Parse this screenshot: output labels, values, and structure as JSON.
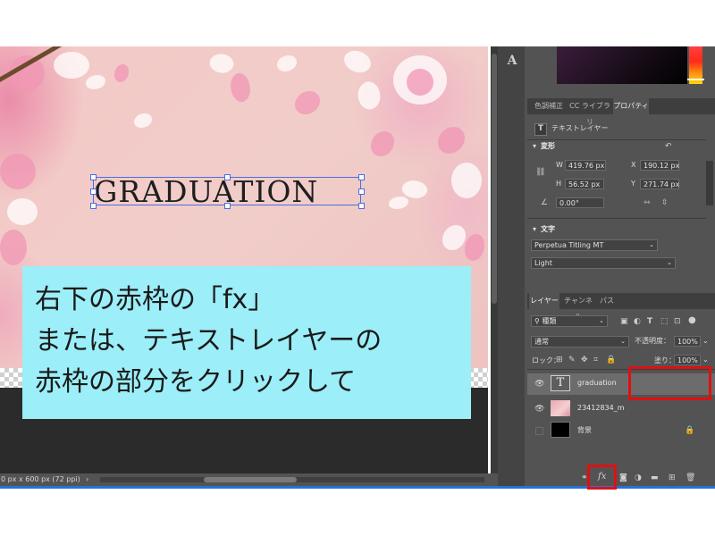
{
  "canvas": {
    "text_layer_content": "GRADUATION",
    "status": "0 px x 600 px (72 ppi)",
    "status_arrow": "›"
  },
  "callout": {
    "line1": "右下の赤枠の「fx」",
    "line2": "または、テキストレイヤーの",
    "line3": "赤枠の部分をクリックして",
    "bg_color": "#9ceef8"
  },
  "toolbar": {
    "type_tool_glyph": "A"
  },
  "properties_panel": {
    "tabs": [
      "色調補正",
      "CC ライブラリ",
      "プロパティ"
    ],
    "active_tab": "プロパティ",
    "layer_type_icon": "T",
    "layer_type": "テキストレイヤー",
    "transform": {
      "title": "変形",
      "w_label": "W",
      "w": "419.76 px",
      "x_label": "X",
      "x": "190.12 px",
      "h_label": "H",
      "h": "56.52 px",
      "y_label": "Y",
      "y": "271.74 px",
      "angle": "0.00°"
    },
    "character": {
      "title": "文字",
      "font_family": "Perpetua Titling MT",
      "font_style": "Light"
    }
  },
  "layers_panel": {
    "tabs": [
      "レイヤー",
      "チャンネル",
      "パス"
    ],
    "active_tab": "レイヤー",
    "filter_kind": "種類",
    "blend_mode": "通常",
    "opacity_label": "不透明度：",
    "opacity": "100%",
    "lock_label": "ロック：",
    "fill_label": "塗り：",
    "fill": "100%",
    "layers": [
      {
        "name": "graduation",
        "visible": true,
        "type": "text",
        "thumb": "T"
      },
      {
        "name": "23412834_m",
        "visible": true,
        "type": "image"
      },
      {
        "name": "背景",
        "visible": false,
        "type": "background",
        "locked": true
      }
    ],
    "bottom_buttons": [
      "link-icon",
      "fx-icon",
      "mask-icon",
      "adjustment-icon",
      "folder-icon",
      "new-layer-icon",
      "trash-icon"
    ],
    "fx_label": "fx"
  },
  "highlight_color": "#e01010"
}
